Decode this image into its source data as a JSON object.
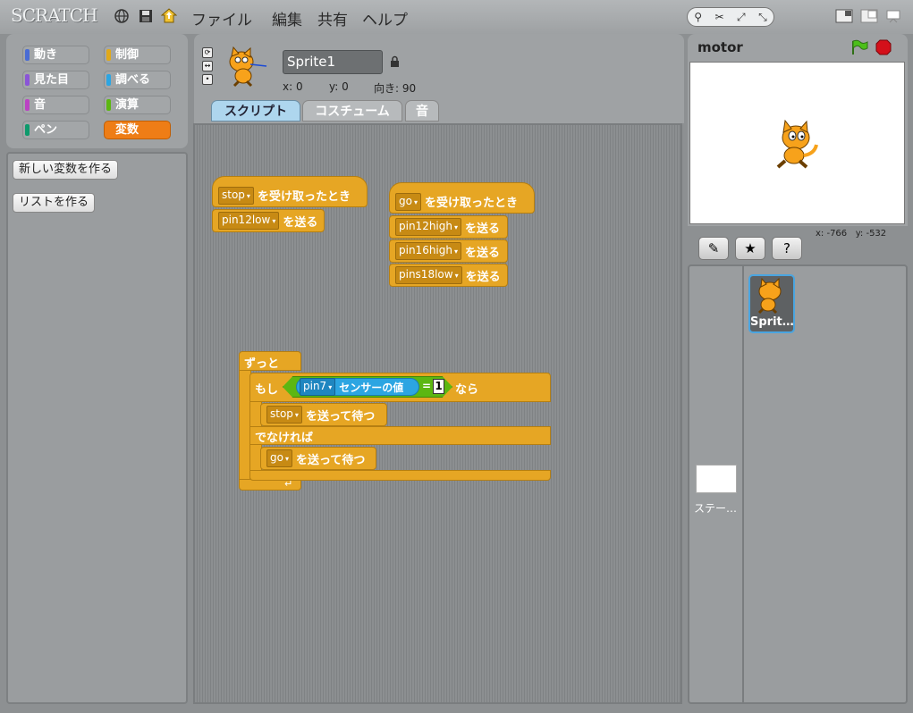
{
  "app": {
    "logo": "SCRATCH"
  },
  "menu": [
    "ファイル",
    "編集",
    "共有",
    "ヘルプ"
  ],
  "categories": [
    {
      "label": "動き",
      "color": "#4a6cd4"
    },
    {
      "label": "制御",
      "color": "#e1a91a"
    },
    {
      "label": "見た目",
      "color": "#8a55d7"
    },
    {
      "label": "調べる",
      "color": "#2ca5e2"
    },
    {
      "label": "音",
      "color": "#bb42c3"
    },
    {
      "label": "演算",
      "color": "#5cb712"
    },
    {
      "label": "ペン",
      "color": "#0e9a6c"
    },
    {
      "label": "変数",
      "color": "#ee7d16"
    }
  ],
  "palette": {
    "new_variable": "新しい変数を作る",
    "new_list": "リストを作る"
  },
  "sprite": {
    "name": "Sprite1",
    "x_label": "x: 0",
    "y_label": "y: 0",
    "direction_label": "向き: 90"
  },
  "tabs": [
    "スクリプト",
    "コスチューム",
    "音"
  ],
  "scripts": {
    "script1": {
      "hat_menu": "stop",
      "hat_text": "を受け取ったとき",
      "b1_menu": "pin12low",
      "b1_text": "を送る"
    },
    "script2": {
      "hat_menu": "go",
      "hat_text": "を受け取ったとき",
      "b1_menu": "pin12high",
      "b2_menu": "pin16high",
      "b3_menu": "pins18low",
      "send_text": "を送る"
    },
    "script3": {
      "forever": "ずっと",
      "if": "もし",
      "sensor_menu": "pin7",
      "sensor_text": "センサーの値",
      "eq": "=",
      "eq_value": "1",
      "then": "なら",
      "b1_menu": "stop",
      "b1_text": "を送って待つ",
      "else": "でなければ",
      "b2_menu": "go",
      "b2_text": "を送って待つ"
    }
  },
  "stage": {
    "title": "motor",
    "mouse_x": "x: -766",
    "mouse_y": "y: -532"
  },
  "sprite_list": {
    "stage_label": "ステー…",
    "sprite_label": "Sprit…"
  }
}
